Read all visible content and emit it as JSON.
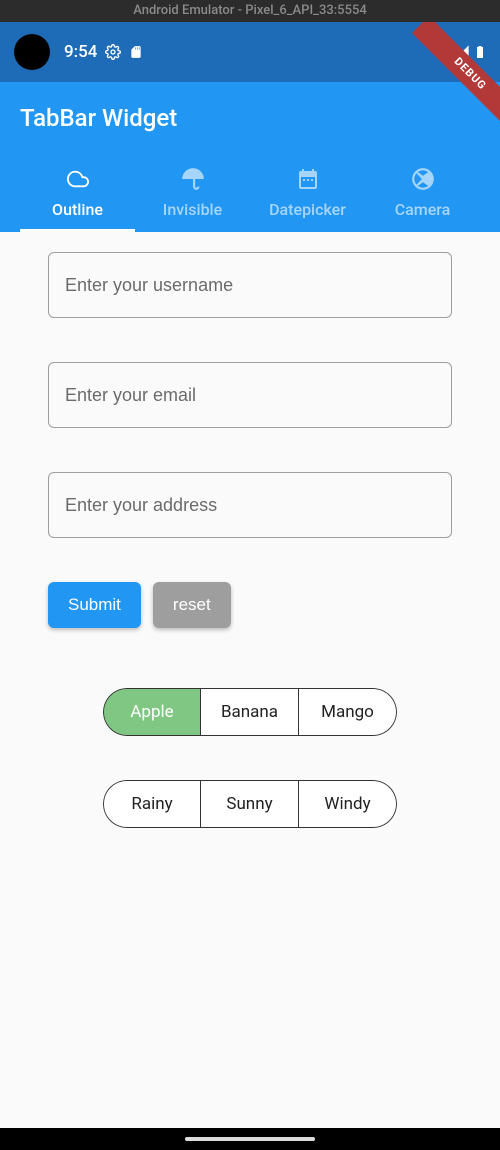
{
  "emulator": {
    "title": "Android Emulator - Pixel_6_API_33:5554"
  },
  "status": {
    "time": "9:54",
    "debug_label": "DEBUG"
  },
  "appbar": {
    "title": "TabBar Widget"
  },
  "tabs": [
    {
      "label": "Outline",
      "icon": "cloud-icon",
      "active": true
    },
    {
      "label": "Invisible",
      "icon": "umbrella-icon",
      "active": false
    },
    {
      "label": "Datepicker",
      "icon": "calendar-icon",
      "active": false
    },
    {
      "label": "Camera",
      "icon": "aperture-icon",
      "active": false
    }
  ],
  "form": {
    "username_placeholder": "Enter your username",
    "email_placeholder": "Enter your email",
    "address_placeholder": "Enter your address",
    "submit_label": "Submit",
    "reset_label": "reset"
  },
  "toggles": {
    "fruit": [
      {
        "label": "Apple",
        "selected": true
      },
      {
        "label": "Banana",
        "selected": false
      },
      {
        "label": "Mango",
        "selected": false
      }
    ],
    "weather": [
      {
        "label": "Rainy",
        "selected": false
      },
      {
        "label": "Sunny",
        "selected": false
      },
      {
        "label": "Windy",
        "selected": false
      }
    ]
  }
}
